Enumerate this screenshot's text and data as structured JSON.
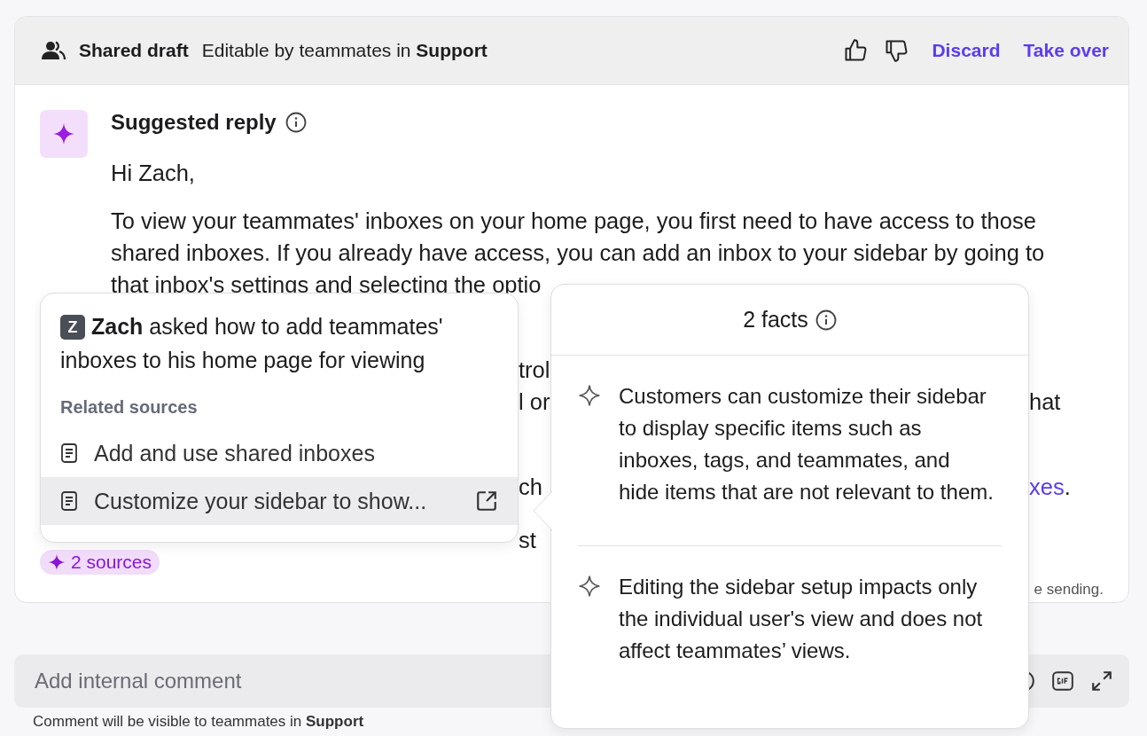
{
  "draft_header": {
    "title": "Shared draft",
    "subtitle": "Editable by teammates in **Support**",
    "actions": [
      "Discard",
      "Take over"
    ]
  },
  "reply": {
    "title": "Suggested reply",
    "greeting": "Hi Zach,",
    "lines": [
      "To view your teammates' inboxes on your home page, you first need to have access to those",
      "shared inboxes. If you already have access, you can add an inbox to your sidebar by going to",
      "that inbox's settings and selecting the optio"
    ],
    "fragments": [
      {
        "left": "trol"
      },
      {
        "left": "l or",
        "right": "hat"
      },
      {
        "left": "ch",
        "right_link": "xes",
        "right": "."
      },
      {
        "left": "st"
      }
    ],
    "note": "e sending.",
    "sources": "2 sources"
  },
  "sources_popover": {
    "avatar": "Z",
    "summary": "**Zach** asked how to add teammates' inboxes to his home page for viewing",
    "section": "Related sources",
    "items": [
      {
        "title": "Add and use shared inboxes",
        "selected": false
      },
      {
        "title": "Customize your sidebar to show...",
        "selected": true
      }
    ]
  },
  "facts_popover": {
    "title": "2 facts",
    "facts": [
      "Customers can customize their sidebar to display specific items such as inboxes, tags, and teammates, and hide items that are not relevant to them.",
      "Editing the sidebar setup impacts only the individual user's view and does not affect teammates’ views."
    ]
  },
  "comment": {
    "placeholder": "Add internal comment",
    "note": "Comment will be visible to teammates in **Support**"
  }
}
